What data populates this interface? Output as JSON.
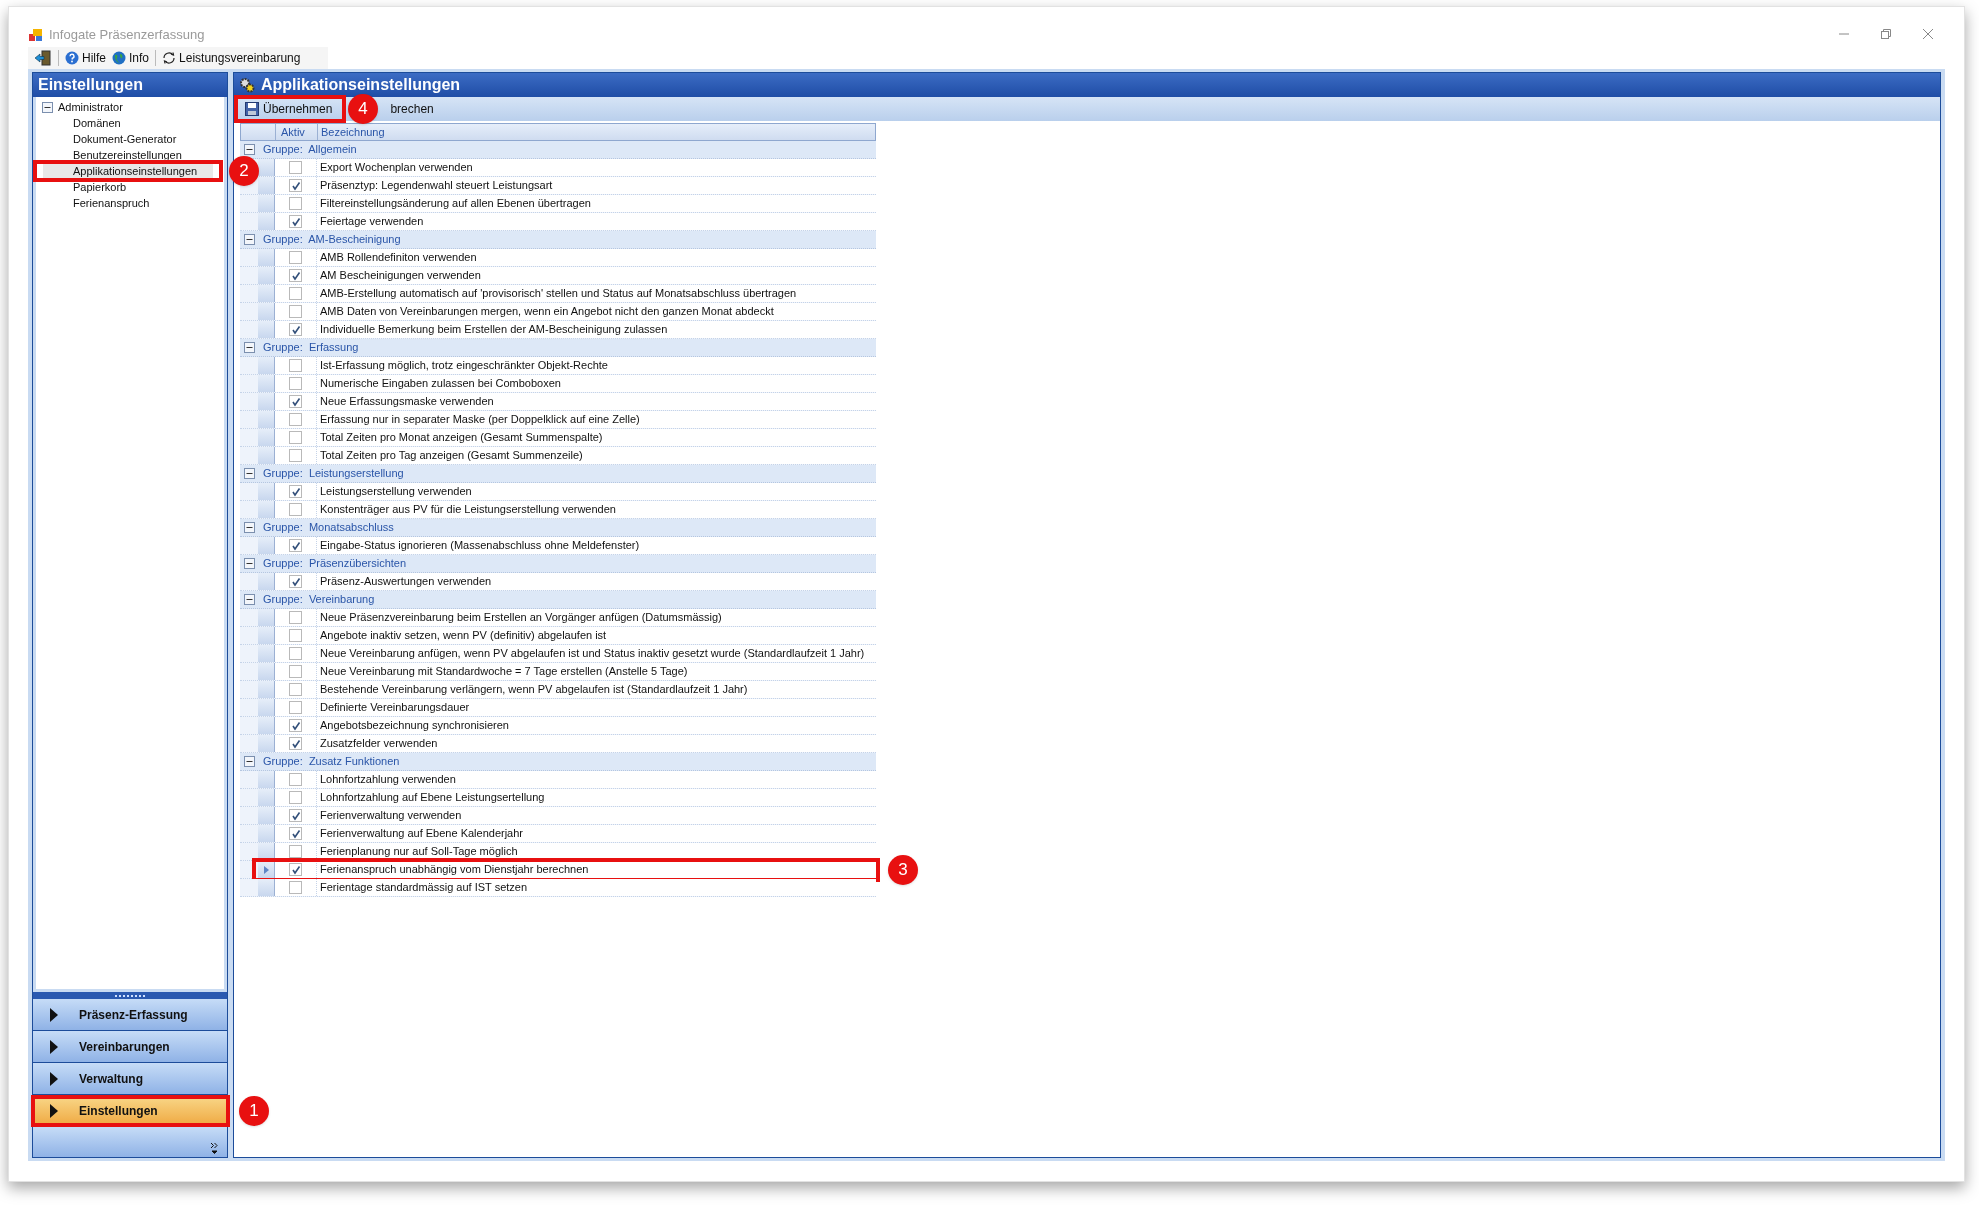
{
  "window": {
    "title": "Infogate Präsenzerfassung"
  },
  "toolbar": [
    {
      "kind": "exit"
    },
    {
      "kind": "help",
      "label": "Hilfe"
    },
    {
      "kind": "globe",
      "label": "Info"
    },
    {
      "kind": "refresh",
      "label": "Leistungsvereinbarung"
    }
  ],
  "sidebar": {
    "title": "Einstellungen",
    "tree": {
      "label": "Administrator",
      "expanded": true,
      "children": [
        {
          "label": "Domänen",
          "selected": false
        },
        {
          "label": "Dokument-Generator",
          "selected": false
        },
        {
          "label": "Benutzereinstellungen",
          "selected": false
        },
        {
          "label": "Applikationseinstellungen",
          "selected": true,
          "callout": "2"
        },
        {
          "label": "Papierkorb",
          "selected": false
        },
        {
          "label": "Ferienanspruch",
          "selected": false
        }
      ]
    },
    "nav": [
      {
        "label": "Präsenz-Erfassung",
        "selected": false
      },
      {
        "label": "Vereinbarungen",
        "selected": false
      },
      {
        "label": "Verwaltung",
        "selected": false
      },
      {
        "label": "Einstellungen",
        "selected": true,
        "callout": "1"
      }
    ]
  },
  "main": {
    "title": "Applikationseinstellungen",
    "actions": [
      {
        "kind": "save",
        "label": "Übernehmen",
        "callout": "4"
      },
      {
        "kind": "plain",
        "label": "brechen"
      }
    ],
    "columns": [
      "Aktiv",
      "Bezeichnung"
    ],
    "groups": [
      {
        "prefix": "Gruppe:",
        "name": "Allgemein",
        "expanded": true,
        "rows": [
          {
            "checked": false,
            "label": "Export Wochenplan verwenden"
          },
          {
            "checked": true,
            "label": "Präsenztyp: Legendenwahl steuert Leistungsart"
          },
          {
            "checked": false,
            "label": "Filtereinstellungsänderung auf allen Ebenen übertragen"
          },
          {
            "checked": true,
            "label": "Feiertage verwenden"
          }
        ]
      },
      {
        "prefix": "Gruppe:",
        "name": "AM-Bescheinigung",
        "expanded": true,
        "rows": [
          {
            "checked": false,
            "label": "AMB Rollendefiniton verwenden"
          },
          {
            "checked": true,
            "label": "AM Bescheinigungen verwenden"
          },
          {
            "checked": false,
            "label": "AMB-Erstellung automatisch auf 'provisorisch' stellen und Status auf Monatsabschluss übertragen"
          },
          {
            "checked": false,
            "label": "AMB Daten von Vereinbarungen mergen, wenn ein Angebot nicht den ganzen Monat abdeckt"
          },
          {
            "checked": true,
            "label": "Individuelle Bemerkung beim Erstellen der AM-Bescheinigung zulassen"
          }
        ]
      },
      {
        "prefix": "Gruppe:",
        "name": "Erfassung",
        "expanded": true,
        "rows": [
          {
            "checked": false,
            "label": "Ist-Erfassung möglich, trotz eingeschränkter Objekt-Rechte"
          },
          {
            "checked": false,
            "label": "Numerische Eingaben zulassen bei Comboboxen"
          },
          {
            "checked": true,
            "label": "Neue Erfassungsmaske verwenden"
          },
          {
            "checked": false,
            "label": "Erfassung nur in separater Maske (per Doppelklick auf eine Zelle)"
          },
          {
            "checked": false,
            "label": "Total Zeiten pro Monat anzeigen (Gesamt Summenspalte)"
          },
          {
            "checked": false,
            "label": "Total Zeiten pro Tag anzeigen (Gesamt Summenzeile)"
          }
        ]
      },
      {
        "prefix": "Gruppe:",
        "name": "Leistungserstellung",
        "expanded": true,
        "rows": [
          {
            "checked": true,
            "label": "Leistungserstellung verwenden"
          },
          {
            "checked": false,
            "label": "Konstenträger aus PV für die Leistungserstellung verwenden"
          }
        ]
      },
      {
        "prefix": "Gruppe:",
        "name": "Monatsabschluss",
        "expanded": true,
        "rows": [
          {
            "checked": true,
            "label": "Eingabe-Status ignorieren (Massenabschluss ohne Meldefenster)"
          }
        ]
      },
      {
        "prefix": "Gruppe:",
        "name": "Präsenzübersichten",
        "expanded": true,
        "rows": [
          {
            "checked": true,
            "label": "Präsenz-Auswertungen verwenden"
          }
        ]
      },
      {
        "prefix": "Gruppe:",
        "name": "Vereinbarung",
        "expanded": true,
        "rows": [
          {
            "checked": false,
            "label": "Neue Präsenzvereinbarung beim Erstellen an Vorgänger anfügen (Datumsmässig)"
          },
          {
            "checked": false,
            "label": "Angebote inaktiv setzen, wenn PV (definitiv) abgelaufen ist"
          },
          {
            "checked": false,
            "label": "Neue Vereinbarung anfügen, wenn PV abgelaufen ist und Status inaktiv gesetzt wurde (Standardlaufzeit 1 Jahr)"
          },
          {
            "checked": false,
            "label": "Neue Vereinbarung mit Standardwoche = 7 Tage erstellen (Anstelle 5 Tage)"
          },
          {
            "checked": false,
            "label": "Bestehende Vereinbarung verlängern, wenn PV abgelaufen ist (Standardlaufzeit 1 Jahr)"
          },
          {
            "checked": false,
            "label": "Definierte Vereinbarungsdauer"
          },
          {
            "checked": true,
            "label": "Angebotsbezeichnung synchronisieren"
          },
          {
            "checked": true,
            "label": "Zusatzfelder verwenden"
          }
        ]
      },
      {
        "prefix": "Gruppe:",
        "name": "Zusatz Funktionen",
        "expanded": true,
        "rows": [
          {
            "checked": false,
            "label": "Lohnfortzahlung verwenden"
          },
          {
            "checked": false,
            "label": "Lohnfortzahlung auf Ebene Leistungsertellung"
          },
          {
            "checked": true,
            "label": "Ferienverwaltung verwenden"
          },
          {
            "checked": true,
            "label": "Ferienverwaltung auf Ebene Kalenderjahr"
          },
          {
            "checked": false,
            "label": "Ferienplanung nur auf Soll-Tage möglich"
          },
          {
            "checked": true,
            "label": "Ferienanspruch unabhängig vom Dienstjahr berechnen",
            "current": true,
            "callout": "3"
          },
          {
            "checked": false,
            "label": "Ferientage standardmässig auf IST setzen"
          }
        ]
      }
    ]
  }
}
